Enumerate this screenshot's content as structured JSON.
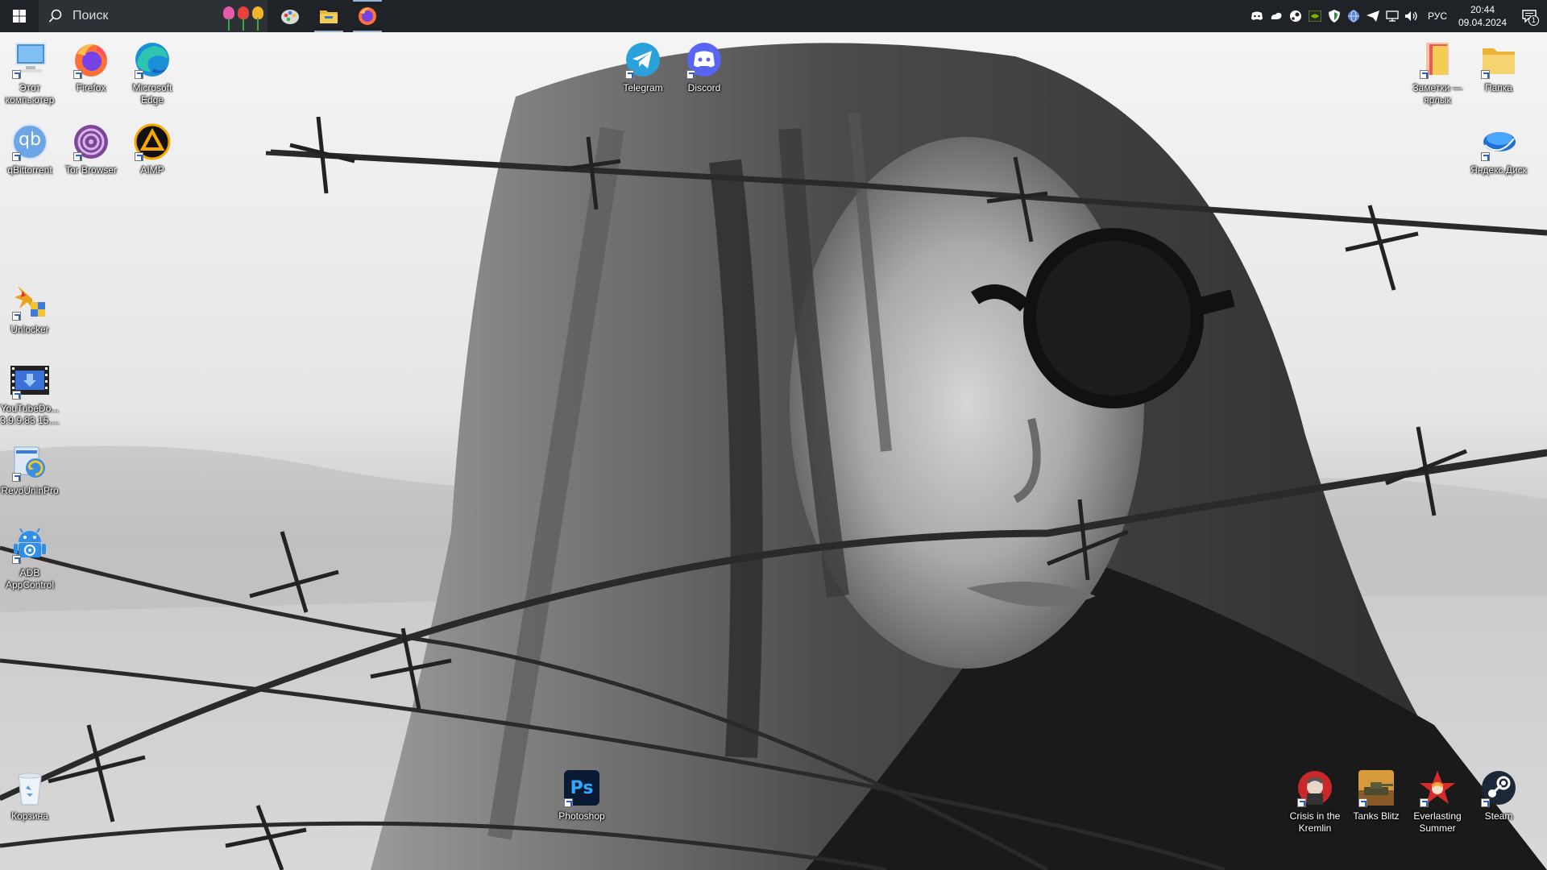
{
  "taskbar": {
    "search_placeholder": "Поиск",
    "pinned": [
      "paint-icon",
      "file-explorer-icon",
      "firefox-icon"
    ],
    "tray": {
      "icons": [
        "discord-icon",
        "cloud-icon",
        "steam-icon",
        "nvidia-icon",
        "shield-icon",
        "globe-icon",
        "telegram-icon",
        "network-icon",
        "volume-icon"
      ],
      "language": "РУС",
      "time": "20:44",
      "date": "09.04.2024",
      "notification_count": "1"
    }
  },
  "desktop": {
    "icons": {
      "this_pc": "Этот компьютер",
      "firefox": "Firefox",
      "edge": "Microsoft Edge",
      "qbittorrent": "qBittorrent",
      "tor_browser": "Tor Browser",
      "aimp": "AIMP",
      "unlocker": "Unlocker",
      "youtube_downloader": "YouTubeDo... 3.9.9.83 15....",
      "revo_uninstaller": "RevoUninPro",
      "adb_appcontrol": "ADB AppControl",
      "recycle_bin": "Корзина",
      "telegram": "Telegram",
      "discord": "Discord",
      "photoshop": "Photoshop",
      "notes_shortcut": "Заметки — ярлык",
      "folder": "Папка",
      "yandex_disk": "Яндекс.Диск",
      "crisis_kremlin": "Crisis in the Kremlin",
      "tanks_blitz": "Tanks Blitz",
      "everlasting_summer": "Everlasting Summer",
      "steam": "Steam"
    },
    "photoshop_badge": "Ps",
    "qbittorrent_badge": "qb"
  }
}
